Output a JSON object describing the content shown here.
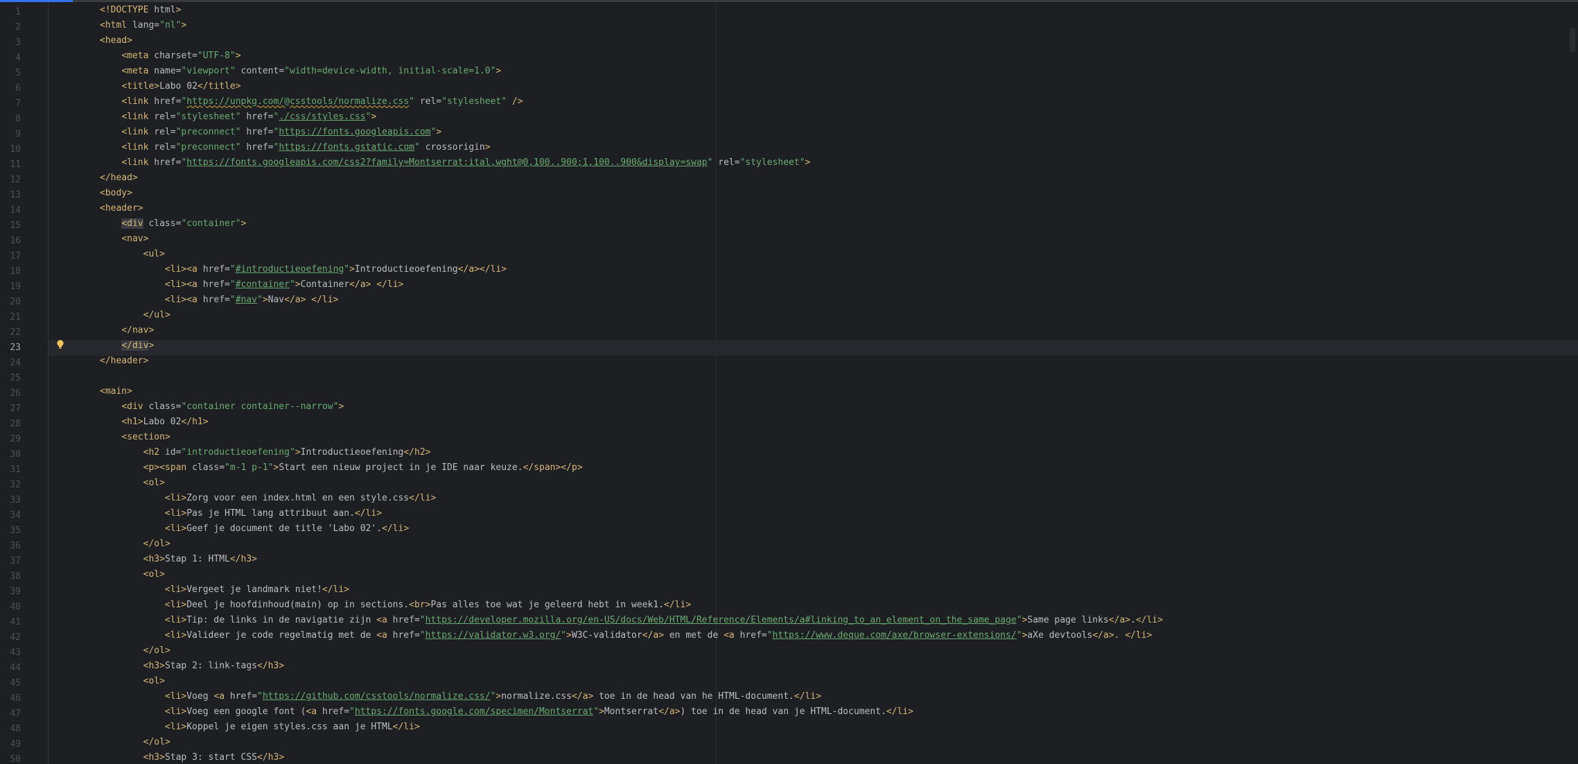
{
  "editor": {
    "current_line": 23,
    "lines": [
      {
        "n": "1",
        "t": "<!DOCTYPE html>"
      },
      {
        "n": "2",
        "t": "<html lang=\"nl\">"
      },
      {
        "n": "3",
        "t": "<head>"
      },
      {
        "n": "4",
        "t": "    <meta charset=\"UTF-8\">"
      },
      {
        "n": "5",
        "t": "    <meta name=\"viewport\" content=\"width=device-width, initial-scale=1.0\">"
      },
      {
        "n": "6",
        "t": "    <title>Labo 02</title>"
      },
      {
        "n": "7",
        "t": "    <link href=\"https://unpkg.com/@csstools/normalize.css\" rel=\"stylesheet\" />"
      },
      {
        "n": "8",
        "t": "    <link rel=\"stylesheet\" href=\"./css/styles.css\">"
      },
      {
        "n": "9",
        "t": "    <link rel=\"preconnect\" href=\"https://fonts.googleapis.com\">"
      },
      {
        "n": "10",
        "t": "    <link rel=\"preconnect\" href=\"https://fonts.gstatic.com\" crossorigin>"
      },
      {
        "n": "11",
        "t": "    <link href=\"https://fonts.googleapis.com/css2?family=Montserrat:ital,wght@0,100..900;1,100..900&display=swap\" rel=\"stylesheet\">"
      },
      {
        "n": "12",
        "t": "</head>"
      },
      {
        "n": "13",
        "t": "<body>"
      },
      {
        "n": "14",
        "t": "<header>"
      },
      {
        "n": "15",
        "t": "    <div class=\"container\">"
      },
      {
        "n": "16",
        "t": "    <nav>"
      },
      {
        "n": "17",
        "t": "        <ul>"
      },
      {
        "n": "18",
        "t": "            <li><a href=\"#introductieoefening\">Introductieoefening</a></li>"
      },
      {
        "n": "19",
        "t": "            <li><a href=\"#container\">Container</a> </li>"
      },
      {
        "n": "20",
        "t": "            <li><a href=\"#nav\">Nav</a> </li>"
      },
      {
        "n": "21",
        "t": "        </ul>"
      },
      {
        "n": "22",
        "t": "    </nav>"
      },
      {
        "n": "23",
        "t": "    </div>"
      },
      {
        "n": "24",
        "t": "</header>"
      },
      {
        "n": "25",
        "t": ""
      },
      {
        "n": "26",
        "t": "<main>"
      },
      {
        "n": "27",
        "t": "    <div class=\"container container--narrow\">"
      },
      {
        "n": "28",
        "t": "    <h1>Labo 02</h1>"
      },
      {
        "n": "29",
        "t": "    <section>"
      },
      {
        "n": "30",
        "t": "        <h2 id=\"introductieoefening\">Introductieoefening</h2>"
      },
      {
        "n": "31",
        "t": "        <p><span class=\"m-1 p-1\">Start een nieuw project in je IDE naar keuze.</span></p>"
      },
      {
        "n": "32",
        "t": "        <ol>"
      },
      {
        "n": "33",
        "t": "            <li>Zorg voor een index.html en een style.css</li>"
      },
      {
        "n": "34",
        "t": "            <li>Pas je HTML lang attribuut aan.</li>"
      },
      {
        "n": "35",
        "t": "            <li>Geef je document de title 'Labo 02'.</li>"
      },
      {
        "n": "36",
        "t": "        </ol>"
      },
      {
        "n": "37",
        "t": "        <h3>Stap 1: HTML</h3>"
      },
      {
        "n": "38",
        "t": "        <ol>"
      },
      {
        "n": "39",
        "t": "            <li>Vergeet je landmark niet!</li>"
      },
      {
        "n": "40",
        "t": "            <li>Deel je hoofdinhoud(main) op in sections.<br>Pas alles toe wat je geleerd hebt in week1.</li>"
      },
      {
        "n": "41",
        "t": "            <li>Tip: de links in de navigatie zijn <a href=\"https://developer.mozilla.org/en-US/docs/Web/HTML/Reference/Elements/a#linking_to_an_element_on_the_same_page\">Same page links</a>.</li>"
      },
      {
        "n": "42",
        "t": "            <li>Valideer je code regelmatig met de <a href=\"https://validator.w3.org/\">W3C-validator</a> en met de <a href=\"https://www.deque.com/axe/browser-extensions/\">aXe devtools</a>. </li>"
      },
      {
        "n": "43",
        "t": "        </ol>"
      },
      {
        "n": "44",
        "t": "        <h3>Stap 2: link-tags</h3>"
      },
      {
        "n": "45",
        "t": "        <ol>"
      },
      {
        "n": "46",
        "t": "            <li>Voeg <a href=\"https://github.com/csstools/normalize.css/\">normalize.css</a> toe in de head van he HTML-document.</li>"
      },
      {
        "n": "47",
        "t": "            <li>Voeg een google font (<a href=\"https://fonts.google.com/specimen/Montserrat\">Montserrat</a>) toe in de head van je HTML-document.</li>"
      },
      {
        "n": "48",
        "t": "            <li>Koppel je eigen styles.css aan je HTML</li>"
      },
      {
        "n": "49",
        "t": "        </ol>"
      },
      {
        "n": "50",
        "t": "        <h3>Stap 3: start CSS</h3>"
      }
    ]
  },
  "icons": {
    "intention": "lightbulb-icon"
  },
  "colors": {
    "background": "#1e1f22",
    "tag": "#d5b778",
    "string": "#6aab73",
    "text": "#bcbec4",
    "line_number": "#4b5059",
    "accent": "#3574f0"
  }
}
